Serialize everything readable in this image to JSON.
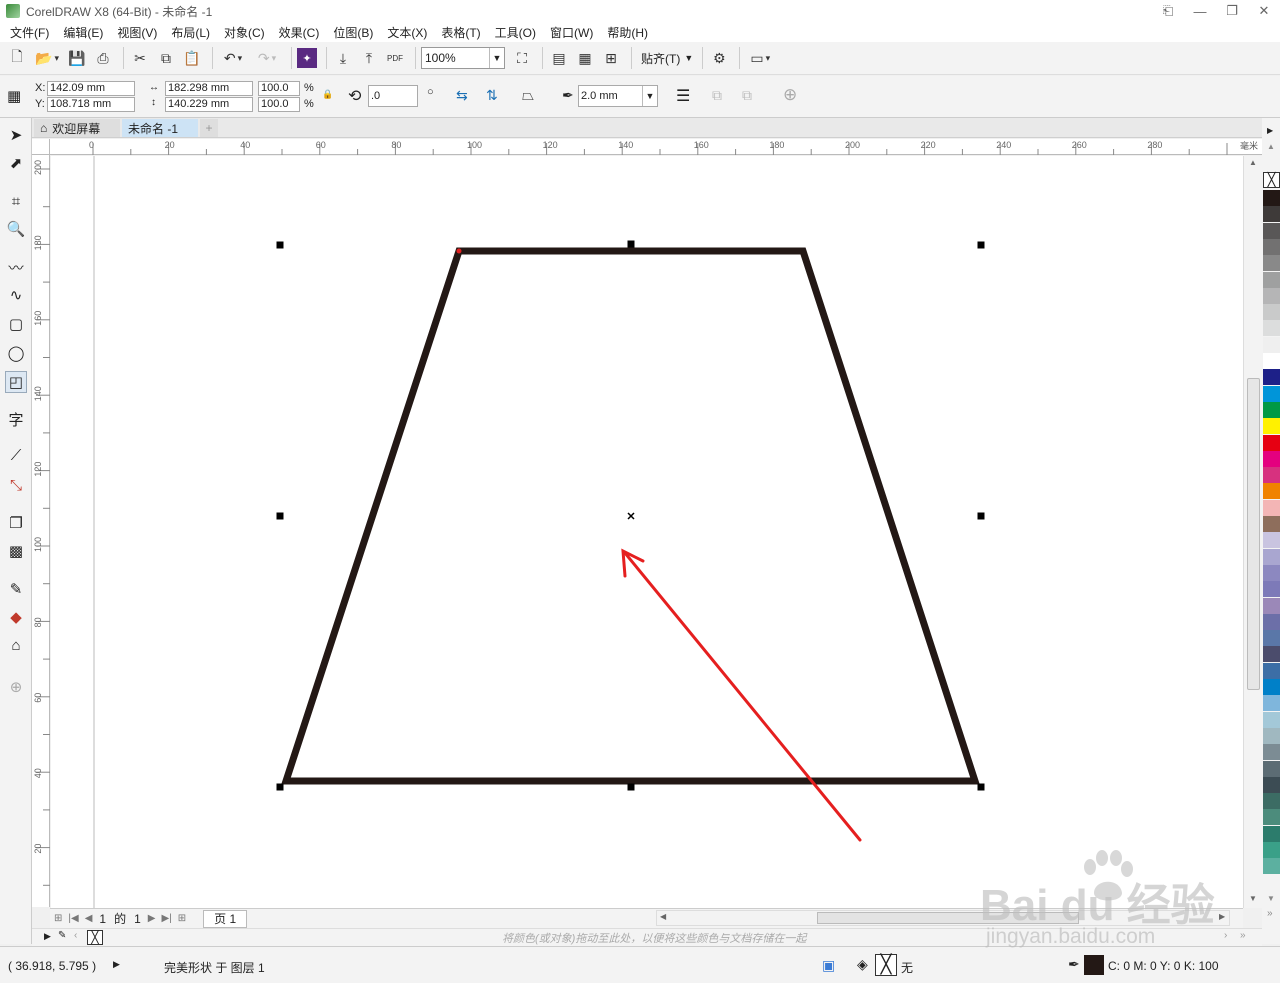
{
  "window": {
    "title": "CorelDRAW X8 (64-Bit) - 未命名 -1"
  },
  "menu": [
    "文件(F)",
    "编辑(E)",
    "视图(V)",
    "布局(L)",
    "对象(C)",
    "效果(C)",
    "位图(B)",
    "文本(X)",
    "表格(T)",
    "工具(O)",
    "窗口(W)",
    "帮助(H)"
  ],
  "toolbar": {
    "zoom": "100%",
    "snap_label": "贴齐(T)",
    "pdf_label": "PDF"
  },
  "propbar": {
    "x": "142.09 mm",
    "y": "108.718 mm",
    "width": "182.298 mm",
    "height": "140.229 mm",
    "scale_w": "100.0",
    "scale_h": "100.0",
    "pct": "%",
    "rotation": ".0",
    "outline": "2.0 mm",
    "x_label": "X:",
    "y_label": "Y:"
  },
  "tabs": {
    "welcome": "欢迎屏幕",
    "doc": "未命名 -1",
    "plus": "+"
  },
  "ruler": {
    "h_labels": [
      "0",
      "20",
      "40",
      "60",
      "80",
      "100",
      "120",
      "140",
      "160",
      "180",
      "200",
      "220",
      "240",
      "260",
      "280"
    ],
    "v_labels": [
      "200",
      "180",
      "160",
      "140",
      "120",
      "100",
      "80",
      "60",
      "40",
      "20"
    ],
    "unit": "毫米"
  },
  "pagenav": {
    "current": "1",
    "of": "的",
    "total": "1",
    "page_tab": "页 1"
  },
  "docpalette": {
    "hint": "将颜色(或对象)拖动至此处，以便将这些颜色与文档存储在一起"
  },
  "status": {
    "coords": "( 36.918, 5.795 )",
    "object": "完美形状 于 图层 1",
    "fill": "无",
    "outline": "C: 0 M: 0 Y: 0 K: 100"
  },
  "palette_colors": [
    "#231815",
    "#3e3a39",
    "#595757",
    "#727171",
    "#898989",
    "#9fa0a0",
    "#b5b5b6",
    "#c9caca",
    "#dcdddd",
    "#efefef",
    "#ffffff",
    "#1d2088",
    "#0095d9",
    "#009944",
    "#fff100",
    "#e60012",
    "#e4007f",
    "#d7317f",
    "#f08300",
    "#f3b5b5",
    "#8e6e5c",
    "#c9c4e0",
    "#a9a6d0",
    "#8c88c0",
    "#7d7ab8",
    "#9b88b8",
    "#6c6fa8",
    "#5a77a8",
    "#4b4c6c",
    "#3c6ea6",
    "#0080c8",
    "#7fb6dc",
    "#a3c8d8",
    "#a0b8c0",
    "#7c8c94",
    "#5c6c74",
    "#3c4c54",
    "#3c6c64",
    "#4c8c7c",
    "#2c7c6c",
    "#3aa088",
    "#5cb0a0"
  ],
  "watermark": {
    "brand": "Bai  du 经验",
    "url": "jingyan.baidu.com"
  }
}
